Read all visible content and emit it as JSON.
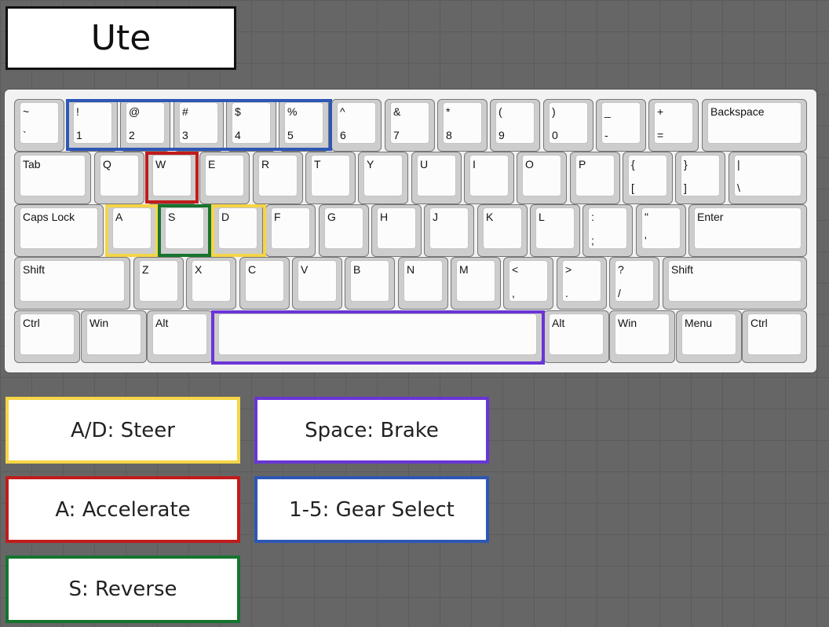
{
  "title": "Ute",
  "keys": {
    "tilde": {
      "top": "~",
      "bottom": "`"
    },
    "n1": {
      "top": "!",
      "bottom": "1"
    },
    "n2": {
      "top": "@",
      "bottom": "2"
    },
    "n3": {
      "top": "#",
      "bottom": "3"
    },
    "n4": {
      "top": "$",
      "bottom": "4"
    },
    "n5": {
      "top": "%",
      "bottom": "5"
    },
    "n6": {
      "top": "^",
      "bottom": "6"
    },
    "n7": {
      "top": "&",
      "bottom": "7"
    },
    "n8": {
      "top": "*",
      "bottom": "8"
    },
    "n9": {
      "top": "(",
      "bottom": "9"
    },
    "n0": {
      "top": ")",
      "bottom": "0"
    },
    "minus": {
      "top": "_",
      "bottom": "-"
    },
    "equals": {
      "top": "+",
      "bottom": "="
    },
    "backspace": "Backspace",
    "tab": "Tab",
    "q": "Q",
    "w": "W",
    "e": "E",
    "r": "R",
    "t": "T",
    "y": "Y",
    "u": "U",
    "i": "I",
    "o": "O",
    "p": "P",
    "lbracket": {
      "top": "{",
      "bottom": "["
    },
    "rbracket": {
      "top": "}",
      "bottom": "]"
    },
    "backslash": {
      "top": "|",
      "bottom": "\\"
    },
    "capslock": "Caps Lock",
    "a": "A",
    "s": "S",
    "d": "D",
    "f": "F",
    "g": "G",
    "h": "H",
    "j": "J",
    "k": "K",
    "l": "L",
    "semicolon": {
      "top": ":",
      "bottom": ";"
    },
    "quote": {
      "top": "\"",
      "bottom": "'"
    },
    "enter": "Enter",
    "lshift": "Shift",
    "z": "Z",
    "x": "X",
    "c": "C",
    "v": "V",
    "b": "B",
    "n": "N",
    "m": "M",
    "comma": {
      "top": "<",
      "bottom": ","
    },
    "period": {
      "top": ">",
      "bottom": "."
    },
    "slash": {
      "top": "?",
      "bottom": "/"
    },
    "rshift": "Shift",
    "lctrl": "Ctrl",
    "lwin": "Win",
    "lalt": "Alt",
    "space": "",
    "ralt": "Alt",
    "rwin": "Win",
    "menu": "Menu",
    "rctrl": "Ctrl"
  },
  "legend": {
    "steer": "A/D: Steer",
    "brake": "Space: Brake",
    "accelerate": "A: Accelerate",
    "gear_select": "1-5: Gear Select",
    "reverse": "S: Reverse"
  },
  "colors": {
    "steer": "#f5d547",
    "brake": "#6a35d6",
    "accelerate": "#c01c1c",
    "gear_select": "#2e57b5",
    "reverse": "#17742f"
  }
}
